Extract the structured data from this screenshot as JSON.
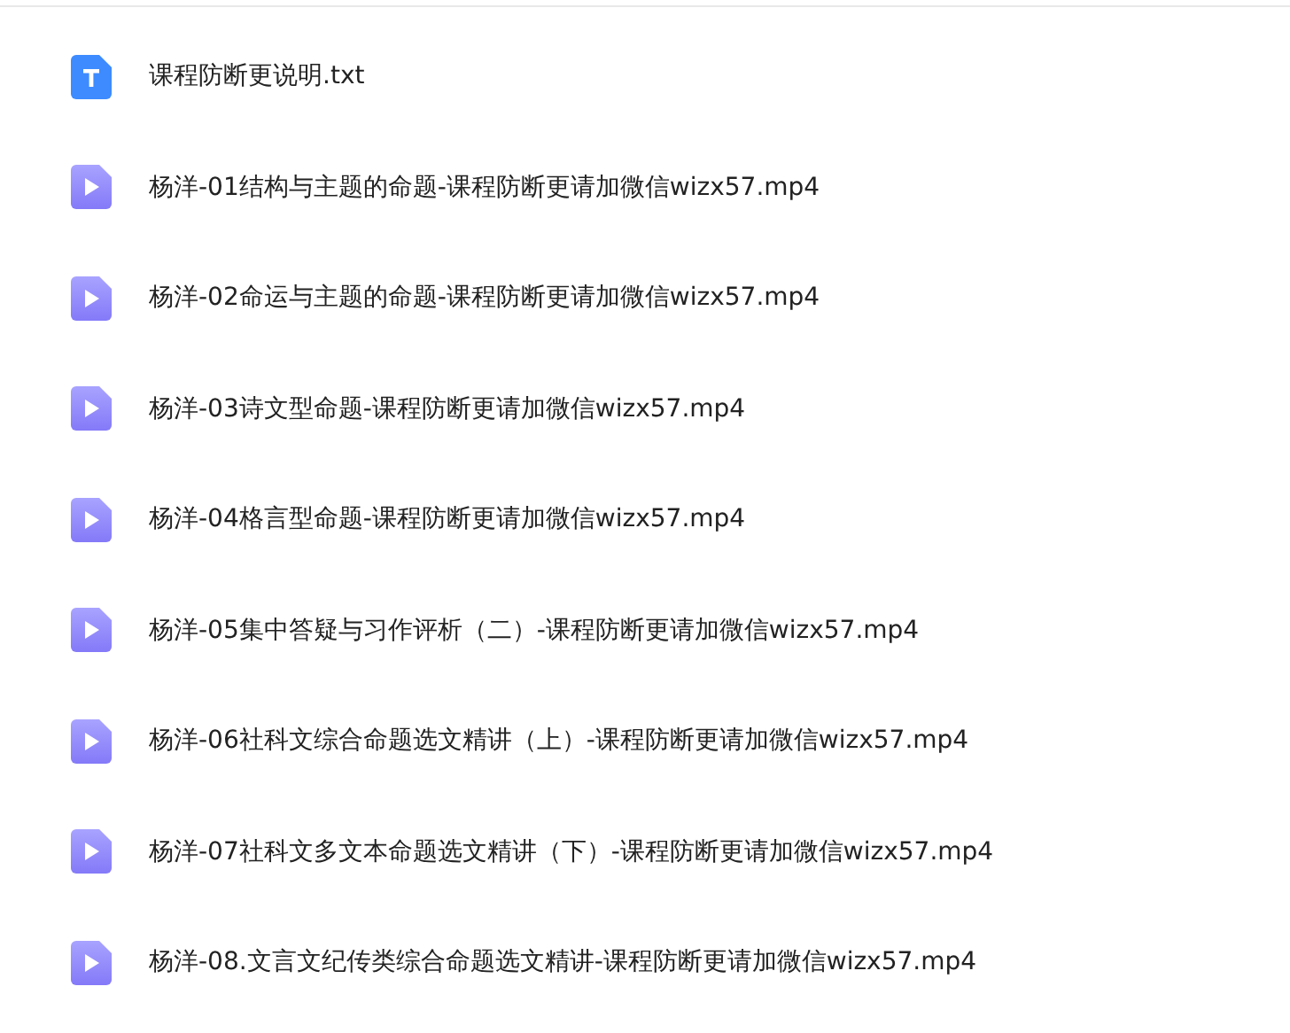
{
  "files": [
    {
      "name": "课程防断更说明.txt",
      "kind": "text"
    },
    {
      "name": "杨洋-01结构与主题的命题-课程防断更请加微信wizx57.mp4",
      "kind": "video"
    },
    {
      "name": "杨洋-02命运与主题的命题-课程防断更请加微信wizx57.mp4",
      "kind": "video"
    },
    {
      "name": "杨洋-03诗文型命题-课程防断更请加微信wizx57.mp4",
      "kind": "video"
    },
    {
      "name": "杨洋-04格言型命题-课程防断更请加微信wizx57.mp4",
      "kind": "video"
    },
    {
      "name": "杨洋-05集中答疑与习作评析（二）-课程防断更请加微信wizx57.mp4",
      "kind": "video"
    },
    {
      "name": "杨洋-06社科文综合命题选文精讲（上）-课程防断更请加微信wizx57.mp4",
      "kind": "video"
    },
    {
      "name": "杨洋-07社科文多文本命题选文精讲（下）-课程防断更请加微信wizx57.mp4",
      "kind": "video"
    },
    {
      "name": "杨洋-08.文言文纪传类综合命题选文精讲-课程防断更请加微信wizx57.mp4",
      "kind": "video"
    }
  ]
}
